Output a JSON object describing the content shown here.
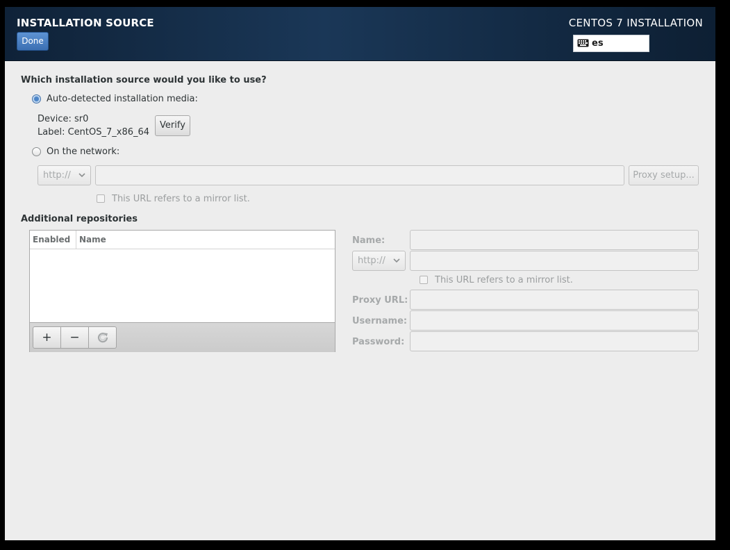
{
  "header": {
    "title": "INSTALLATION SOURCE",
    "done_label": "Done",
    "product_title": "CENTOS 7 INSTALLATION",
    "keyboard_layout": "es"
  },
  "source": {
    "question": "Which installation source would you like to use?",
    "auto_label": "Auto-detected installation media:",
    "auto_selected": true,
    "device_line": "Device: sr0",
    "label_line": "Label: CentOS_7_x86_64",
    "verify_label": "Verify",
    "network_label": "On the network:",
    "protocol": "http://",
    "url_value": "",
    "proxy_button": "Proxy setup...",
    "mirror_label": "This URL refers to a mirror list."
  },
  "repos": {
    "title": "Additional repositories",
    "columns": [
      "Enabled",
      "Name"
    ],
    "rows": [],
    "add_label": "+",
    "remove_label": "−",
    "refresh_icon": "refresh-icon"
  },
  "repo_form": {
    "name_label": "Name:",
    "protocol": "http://",
    "mirror_label": "This URL refers to a mirror list.",
    "proxy_label": "Proxy URL:",
    "username_label": "Username:",
    "password_label": "Password:"
  }
}
